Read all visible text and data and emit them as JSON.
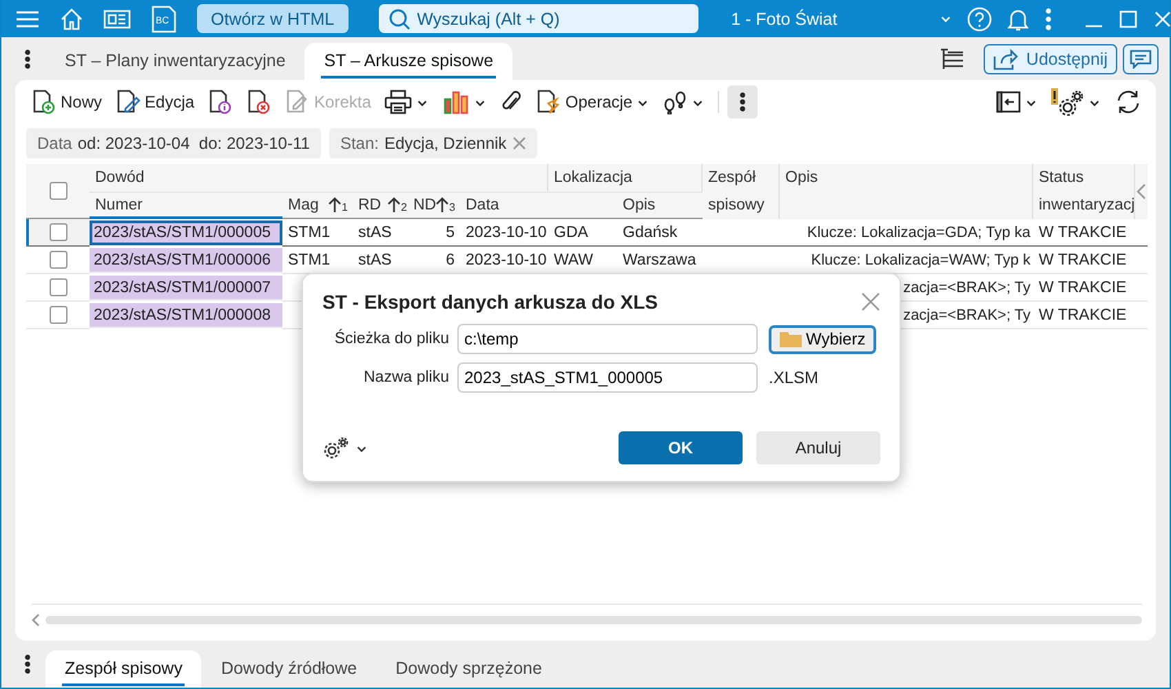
{
  "title_bar": {
    "app_badge": "BC",
    "html_button": "Otwórz w HTML",
    "search": {
      "placeholder": "Wyszukaj (Alt + Q)"
    },
    "company": "1 - Foto Świat"
  },
  "tabs": [
    {
      "label": "ST – Plany inwentaryzacyjne",
      "selected": false
    },
    {
      "label": "ST – Arkusze spisowe",
      "selected": true
    }
  ],
  "share_button": "Udostępnij",
  "toolbar": [
    {
      "label": "Nowy",
      "disabled": false
    },
    {
      "label": "Edycja",
      "disabled": false
    },
    {
      "label": "Korekta",
      "disabled": true
    },
    {
      "label": "Operacje",
      "disabled": false
    }
  ],
  "filters": [
    {
      "label": "Data",
      "value": "od: 2023-10-04  do: 2023-10-11",
      "removable": false
    },
    {
      "label": "Stan:",
      "value": "Edycja, Dziennik",
      "removable": true
    }
  ],
  "table": {
    "group_headers": [
      "Dowód",
      "Lokalizacja"
    ],
    "columns": {
      "numer": "Numer",
      "mag": "Mag",
      "sort_1": "1",
      "rd": "RD",
      "sort_2": "2",
      "nd": "ND",
      "sort_3": "3",
      "data": "Data",
      "lok_opis": "Opis",
      "zespol": "Zespół spisowy",
      "opis": "Opis",
      "status": "Status inwentaryzacj"
    },
    "header_checked": false,
    "rows": [
      {
        "selected": true,
        "checked": false,
        "numer": "2023/stAS/STM1/000005",
        "mag": "STM1",
        "rd": "stAS",
        "nd": "5",
        "data": "2023-10-10",
        "lok": "GDA",
        "lok_opis": "Gdańsk",
        "opis": "Klucze: Lokalizacja=GDA; Typ ka",
        "status": "W TRAKCIE"
      },
      {
        "selected": false,
        "checked": false,
        "numer": "2023/stAS/STM1/000006",
        "mag": "STM1",
        "rd": "stAS",
        "nd": "6",
        "data": "2023-10-10",
        "lok": "WAW",
        "lok_opis": "Warszawa",
        "opis": "Klucze: Lokalizacja=WAW; Typ k",
        "status": "W TRAKCIE"
      },
      {
        "selected": false,
        "checked": false,
        "numer": "2023/stAS/STM1/000007",
        "opis": "zacja=<BRAK>; Ty",
        "status": "W TRAKCIE"
      },
      {
        "selected": false,
        "checked": false,
        "numer": "2023/stAS/STM1/000008",
        "opis": "zacja=<BRAK>; Ty",
        "status": "W TRAKCIE"
      }
    ]
  },
  "bottom_tabs": [
    {
      "label": "Zespół spisowy",
      "selected": true
    },
    {
      "label": "Dowody źródłowe",
      "selected": false
    },
    {
      "label": "Dowody sprzężone",
      "selected": false
    }
  ],
  "dialog": {
    "title": "ST - Eksport danych arkusza do XLS",
    "fields": [
      {
        "label": "Ścieżka do pliku",
        "value": "c:\\temp"
      },
      {
        "label": "Nazwa pliku",
        "value": "2023_stAS_STM1_000005"
      }
    ],
    "browse_button": "Wybierz",
    "extension": ".XLSM",
    "ok_button": "OK",
    "cancel_button": "Anuluj"
  }
}
